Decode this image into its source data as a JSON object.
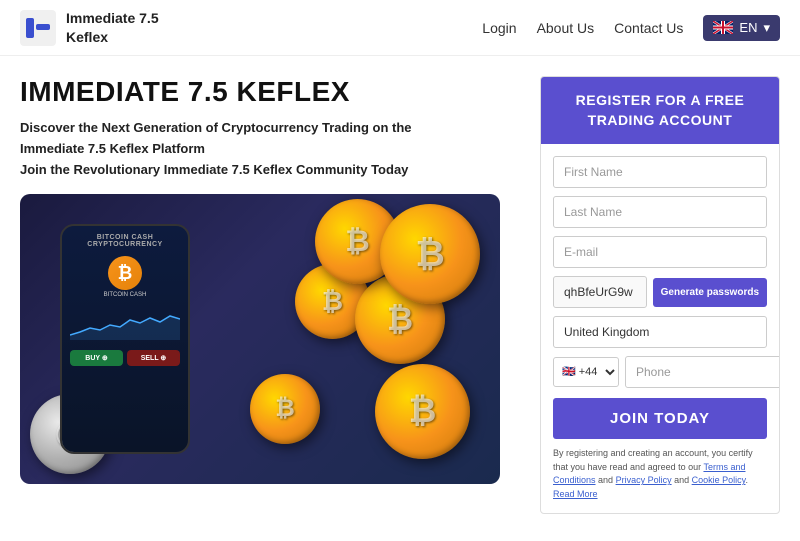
{
  "header": {
    "logo_name": "Immediate 7.5\nKeflex",
    "nav_login": "Login",
    "nav_about": "About Us",
    "nav_contact": "Contact Us",
    "lang_btn": "EN"
  },
  "hero": {
    "title": "IMMEDIATE 7.5 KEFLEX",
    "subtitle_line1": "Discover the Next Generation of Cryptocurrency Trading on the",
    "subtitle_line2": "Immediate 7.5 Keflex Platform",
    "subtitle_line3": "Join the Revolutionary Immediate 7.5 Keflex Community Today"
  },
  "phone_screen": {
    "header": "BITCOIN CASH\nCRYPTOCURRENCY",
    "btc_symbol": "₿",
    "buy_label": "BUY ⊕",
    "sell_label": "SELL ⊕"
  },
  "registration": {
    "header": "REGISTER FOR A FREE TRADING ACCOUNT",
    "first_name_placeholder": "First Name",
    "last_name_placeholder": "Last Name",
    "email_placeholder": "E-mail",
    "password_value": "qhBfeUrG9w",
    "generate_btn": "Generate passwords",
    "country": "United Kingdom",
    "country_code": "🇬🇧 +44",
    "phone_placeholder": "Phone",
    "join_btn": "JOIN TODAY",
    "terms_text": "By registering and creating an account, you certify that you have read and agreed to our ",
    "terms_link1": "Terms and Conditions",
    "terms_and": " and ",
    "terms_link2": "Privacy Policy",
    "terms_and2": " and ",
    "terms_link3": "Cookie Policy",
    "read_more": "Read More"
  },
  "colors": {
    "accent": "#5a4fcf",
    "text_dark": "#111111",
    "text_mid": "#333333"
  }
}
